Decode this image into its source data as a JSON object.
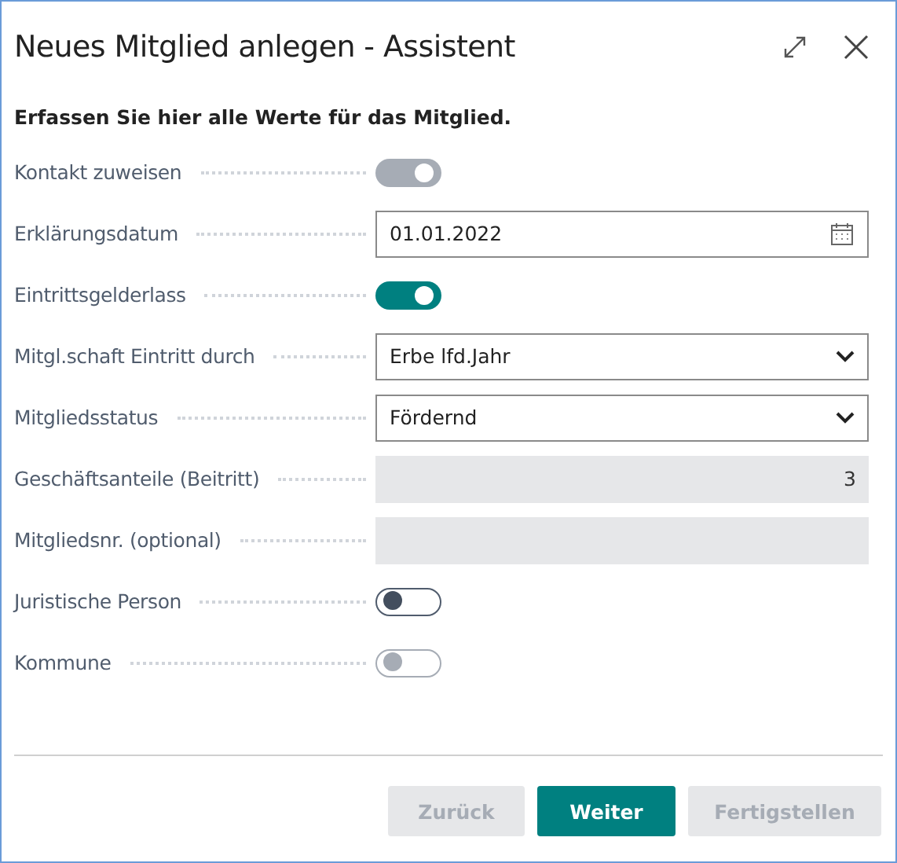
{
  "window": {
    "title": "Neues Mitglied anlegen - Assistent"
  },
  "instruction": "Erfassen Sie hier alle Werte für das Mitglied.",
  "fields": [
    {
      "kind": "toggle",
      "label": "Kontakt zuweisen",
      "on": true,
      "disabled": true
    },
    {
      "kind": "date",
      "label": "Erklärungsdatum",
      "value": "01.01.2022"
    },
    {
      "kind": "toggle",
      "label": "Eintrittsgelderlass",
      "on": true,
      "disabled": false
    },
    {
      "kind": "select",
      "label": "Mitgl.schaft Eintritt durch",
      "value": "Erbe lfd.Jahr"
    },
    {
      "kind": "select",
      "label": "Mitgliedsstatus",
      "value": "Fördernd"
    },
    {
      "kind": "readonly",
      "label": "Geschäftsanteile (Beitritt)",
      "value": "3"
    },
    {
      "kind": "readonly",
      "label": "Mitgliedsnr. (optional)"
    },
    {
      "kind": "toggle",
      "label": "Juristische Person",
      "on": false,
      "disabled": false
    },
    {
      "kind": "toggle",
      "label": "Kommune",
      "on": false,
      "disabled": true
    }
  ],
  "buttons": [
    {
      "label": "Zurück",
      "disabled": true,
      "primary": false
    },
    {
      "label": "Weiter",
      "disabled": false,
      "primary": true
    },
    {
      "label": "Fertigstellen",
      "disabled": true,
      "primary": false
    }
  ]
}
